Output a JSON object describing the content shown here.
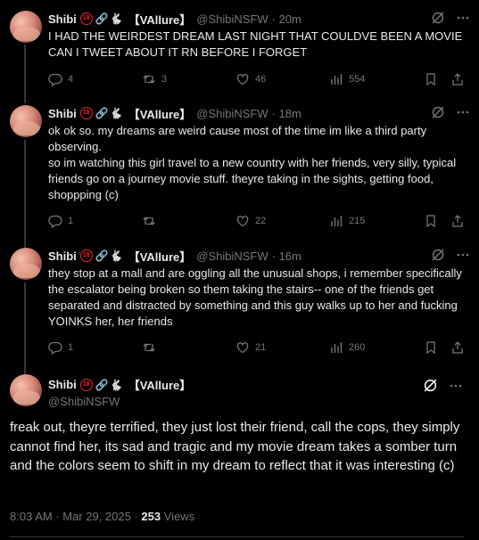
{
  "user": {
    "name": "Shibi",
    "tag": "【VAllure】",
    "handle": "@ShibiNSFW",
    "badge": "18"
  },
  "tweets": [
    {
      "time": "· 20m",
      "text": "I HAD THE WEIRDEST DREAM LAST NIGHT THAT COULDVE BEEN A MOVIE CAN I TWEET ABOUT IT RN BEFORE I FORGET",
      "replies": "4",
      "retweets": "3",
      "likes": "46",
      "views": "554"
    },
    {
      "time": "· 18m",
      "text_lines": [
        "ok ok so. my dreams are weird cause most of the time im like a third party observing.",
        "so im watching this girl travel to a new country with her friends, very silly, typical friends go on a journey movie stuff. theyre taking in the sights, getting food, shoppping (c)"
      ],
      "replies": "1",
      "retweets": "",
      "likes": "22",
      "views": "215"
    },
    {
      "time": "· 16m",
      "text": "they stop at a mall and are oggling all the unusual shops, i remember specifically the escalator being broken so them taking the stairs-- one of the friends get separated and distracted by something and this guy walks up to her and fucking YOINKS her, her friends",
      "replies": "1",
      "retweets": "",
      "likes": "21",
      "views": "260"
    }
  ],
  "main_tweet": {
    "text": "freak out, theyre terrified, they just lost their friend, call the cops, they simply cannot find her, its sad and tragic and my movie dream takes a somber turn and the colors seem to shift in my dream to reflect that it was interesting (c)",
    "timestamp": "8:03 AM · Mar 29, 2025 ·",
    "views_count": "253",
    "views_label": "Views"
  },
  "colors": {
    "background": "#000000",
    "text": "#e7e9ea",
    "muted": "#71767b",
    "badge_red": "#f4212e"
  },
  "icons": [
    "reply-icon",
    "retweet-icon",
    "like-icon",
    "views-icon",
    "bookmark-icon",
    "share-icon",
    "grok-icon",
    "more-icon"
  ]
}
